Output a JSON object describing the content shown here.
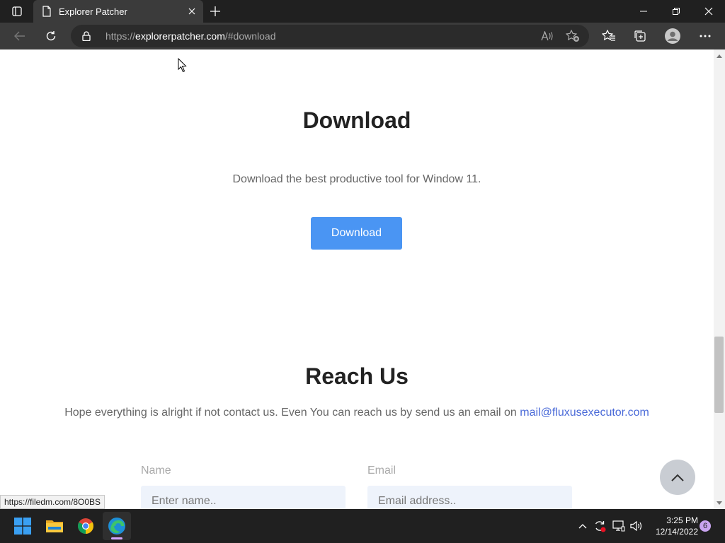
{
  "browser": {
    "tab_title": "Explorer Patcher",
    "url_prefix": "https://",
    "url_host": "explorerpatcher.com",
    "url_path": "/#download",
    "status_url": "https://filedm.com/8O0BS"
  },
  "page": {
    "download_heading": "Download",
    "download_text": "Download the best productive tool for Window 11.",
    "download_button": "Download",
    "reach_heading": "Reach Us",
    "reach_text": "Hope everything is alright if not contact us. Even You can reach us by send us an email on ",
    "reach_email": "mail@fluxusexecutor.com",
    "form": {
      "name_label": "Name",
      "name_placeholder": "Enter name..",
      "email_label": "Email",
      "email_placeholder": "Email address.."
    }
  },
  "taskbar": {
    "apps": [
      "windows-start",
      "file-explorer",
      "chrome",
      "edge"
    ],
    "time": "3:25 PM",
    "date": "12/14/2022",
    "notification_count": "6"
  },
  "colors": {
    "accent_button": "#4a95f3",
    "link": "#4a6ad8"
  }
}
